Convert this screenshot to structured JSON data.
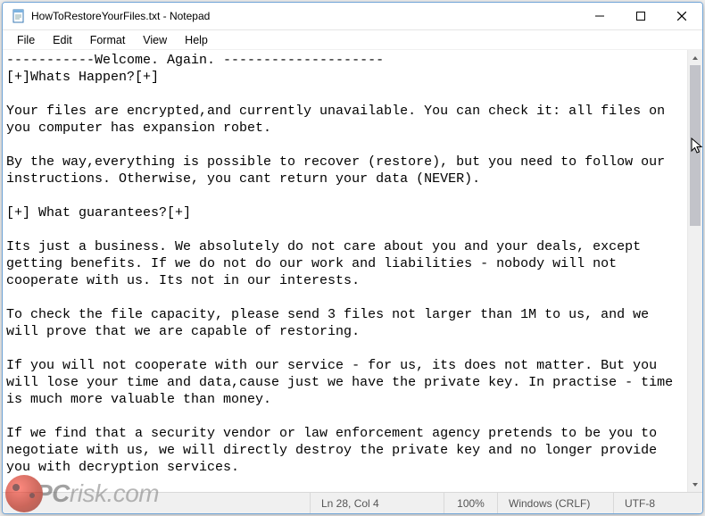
{
  "titlebar": {
    "filename": "HowToRestoreYourFiles.txt",
    "app": "Notepad",
    "separator": " - "
  },
  "menu": {
    "file": "File",
    "edit": "Edit",
    "format": "Format",
    "view": "View",
    "help": "Help"
  },
  "document": {
    "body": "-----------Welcome. Again. --------------------\n[+]Whats Happen?[+]\n\nYour files are encrypted,and currently unavailable. You can check it: all files on you computer has expansion robet.\n\nBy the way,everything is possible to recover (restore), but you need to follow our instructions. Otherwise, you cant return your data (NEVER).\n\n[+] What guarantees?[+]\n\nIts just a business. We absolutely do not care about you and your deals, except getting benefits. If we do not do our work and liabilities - nobody will not cooperate with us. Its not in our interests.\n\nTo check the file capacity, please send 3 files not larger than 1M to us, and we will prove that we are capable of restoring.\n\nIf you will not cooperate with our service - for us, its does not matter. But you will lose your time and data,cause just we have the private key. In practise - time is much more valuable than money.\n\nIf we find that a security vendor or law enforcement agency pretends to be you to negotiate with us, we will directly destroy the private key and no longer provide you with decryption services."
  },
  "statusbar": {
    "position": "Ln 28, Col 4",
    "zoom": "100%",
    "eol": "Windows (CRLF)",
    "encoding": "UTF-8"
  },
  "watermark": {
    "text_a": "PC",
    "text_b": "risk.com"
  },
  "icons": {
    "notepad": "notepad-icon",
    "minimize": "minimize-icon",
    "maximize": "maximize-icon",
    "close": "close-icon",
    "scroll_up": "chevron-up-icon",
    "scroll_down": "chevron-down-icon"
  }
}
